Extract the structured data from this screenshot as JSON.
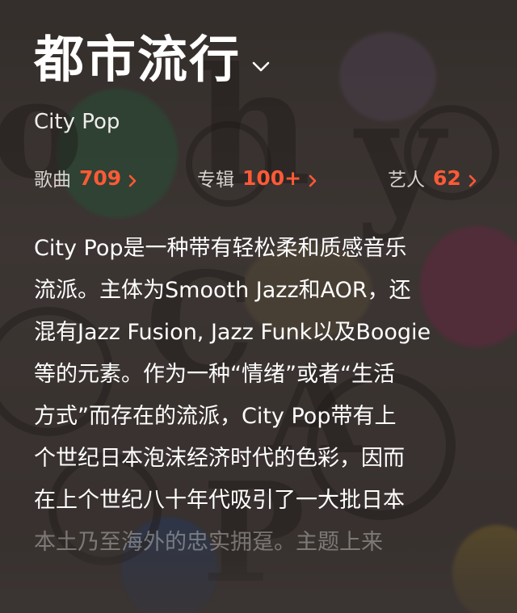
{
  "genre": {
    "title": "都市流行",
    "subtitle": "City Pop"
  },
  "stats": {
    "songs": {
      "label": "歌曲",
      "count": "709"
    },
    "albums": {
      "label": "专辑",
      "count": "100+"
    },
    "artists": {
      "label": "艺人",
      "count": "62"
    }
  },
  "description": {
    "lines": [
      "City Pop是一种带有轻松柔和质感音乐",
      "流派。主体为Smooth Jazz和AOR，还",
      "混有Jazz Fusion, Jazz Funk以及Boogie",
      "等的元素。作为一种“情绪”或者“生活",
      "方式”而存在的流派，City Pop带有上",
      "个世纪日本泡沫经济时代的色彩，因而",
      "在上个世纪八十年代吸引了一大批日本",
      "本土乃至海外的忠实拥趸。主题上来"
    ]
  },
  "colors": {
    "accent": "#ff5a36",
    "text": "#ffffff",
    "muted": "#d8d2cf"
  },
  "icons": {
    "title_dropdown": "chevron-down-icon",
    "stat_arrow": "chevron-right-icon"
  }
}
